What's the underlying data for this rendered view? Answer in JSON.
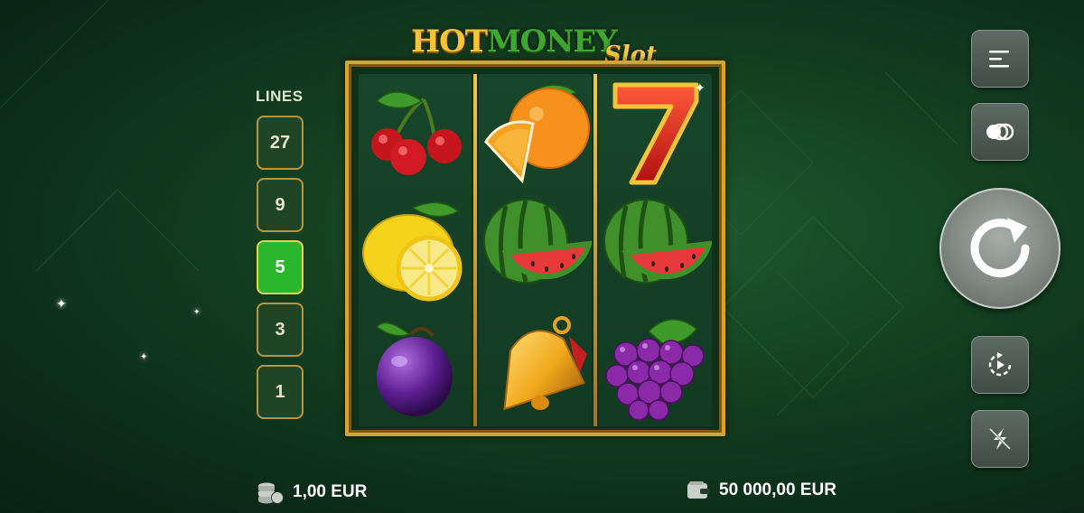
{
  "logo": {
    "part1": "HOT",
    "part2": "MONEY",
    "part3": "Slot"
  },
  "lines": {
    "title": "LINES",
    "options": [
      "27",
      "9",
      "5",
      "3",
      "1"
    ],
    "selected": "5"
  },
  "reels": [
    [
      "cherry",
      "lemon",
      "plum"
    ],
    [
      "orange",
      "watermelon",
      "bell"
    ],
    [
      "seven",
      "watermelon",
      "grapes"
    ]
  ],
  "footer": {
    "bet_value": "1,00 EUR",
    "balance_value": "50 000,00 EUR"
  },
  "icons": {
    "menu": "menu-icon",
    "autoplay_mode": "coins-stack-icon",
    "spin": "spin-icon",
    "auto_spin": "autoplay-icon",
    "turbo": "turbo-icon",
    "bet": "coins-icon",
    "wallet": "wallet-icon"
  },
  "colors": {
    "accent_gold": "#d9a429",
    "active_green": "#29b82b",
    "background": "#123d20"
  }
}
